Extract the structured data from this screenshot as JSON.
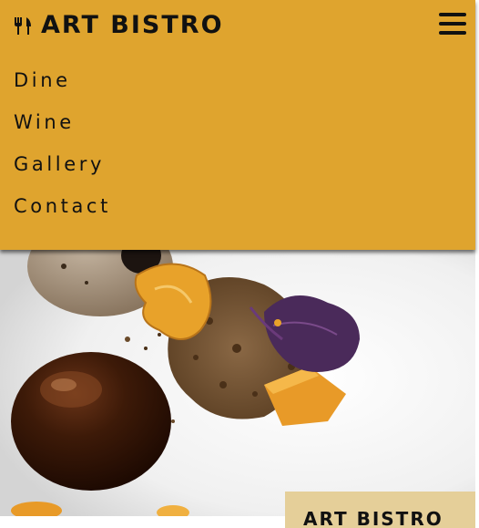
{
  "header": {
    "brand_name": "ART BISTRO",
    "brand_icon": "utensils-icon",
    "menu_icon": "hamburger-icon"
  },
  "nav": {
    "items": [
      {
        "label": "Dine"
      },
      {
        "label": "Wine"
      },
      {
        "label": "Gallery"
      },
      {
        "label": "Contact"
      }
    ]
  },
  "card": {
    "title": "ART BISTRO"
  },
  "colors": {
    "accent": "#dfa42e",
    "text": "#111111",
    "card": "#e5cf99"
  }
}
